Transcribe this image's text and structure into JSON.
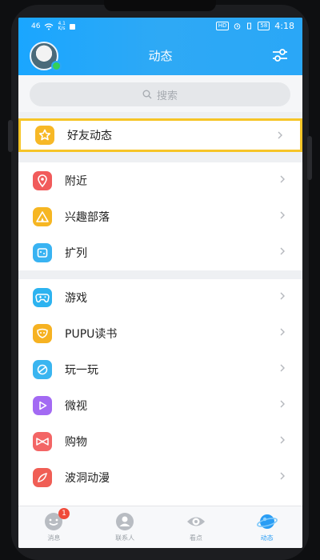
{
  "status_bar": {
    "carrier": "46",
    "net_speed": "4.1\nK/s",
    "badge_hd": "HD",
    "battery": "58",
    "time": "4:18"
  },
  "header": {
    "title": "动态",
    "accent": "#2aa7f7"
  },
  "search": {
    "placeholder": "搜索",
    "icon": "search-icon"
  },
  "sections": [
    {
      "items": [
        {
          "label": "好友动态",
          "icon": "star-icon",
          "color": "#f7b826",
          "highlighted": true
        }
      ]
    },
    {
      "items": [
        {
          "label": "附近",
          "icon": "location-pin-icon",
          "color": "#f15b5b"
        },
        {
          "label": "兴趣部落",
          "icon": "tribe-icon",
          "color": "#f6b622"
        },
        {
          "label": "扩列",
          "icon": "puzzle-icon",
          "color": "#39b3f2"
        }
      ]
    },
    {
      "items": [
        {
          "label": "游戏",
          "icon": "gamepad-icon",
          "color": "#2db3f0"
        },
        {
          "label": "PUPU读书",
          "icon": "book-icon",
          "color": "#f6b222"
        },
        {
          "label": "玩一玩",
          "icon": "play-ball-icon",
          "color": "#3ab5f0"
        },
        {
          "label": "微视",
          "icon": "video-icon",
          "color": "#a36af3"
        },
        {
          "label": "购物",
          "icon": "bow-icon",
          "color": "#f36565"
        },
        {
          "label": "波洞动漫",
          "icon": "comic-icon",
          "color": "#f05e55"
        }
      ]
    }
  ],
  "tabbar": {
    "tabs": [
      {
        "label": "消息",
        "icon": "message-icon",
        "badge": "1"
      },
      {
        "label": "联系人",
        "icon": "contacts-icon"
      },
      {
        "label": "看点",
        "icon": "eye-icon"
      },
      {
        "label": "动态",
        "icon": "planet-icon",
        "active": true
      }
    ]
  }
}
